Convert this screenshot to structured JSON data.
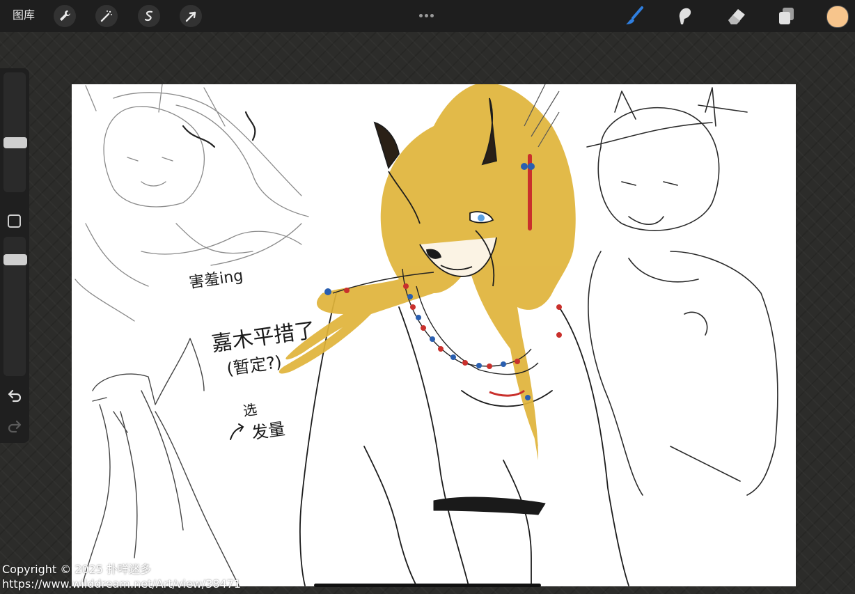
{
  "topbar": {
    "gallery_label": "图库",
    "tools_left": [
      "wrench-icon",
      "magic-wand-icon",
      "selection-icon",
      "transform-arrow-icon"
    ],
    "tools_right": [
      "brush-icon",
      "smudge-icon",
      "eraser-icon",
      "layers-icon"
    ],
    "active_tool": "brush-icon",
    "color": "#f7c58c",
    "accent": "#2f7fe0"
  },
  "canvas": {
    "note_shy": "害羞ing",
    "note_name": "嘉木平措了",
    "note_tentative": "(暂定?)",
    "note_hair_a": "选",
    "note_hair_b": "发量",
    "hair_color": "#e0b43a",
    "bead_red": "#c9302c",
    "bead_blue": "#2a5fb0"
  },
  "watermark": {
    "line1": "Copyright © 2025 扑咩迷多",
    "line2": "https://www.wilddream.net/Art/view/38471"
  }
}
